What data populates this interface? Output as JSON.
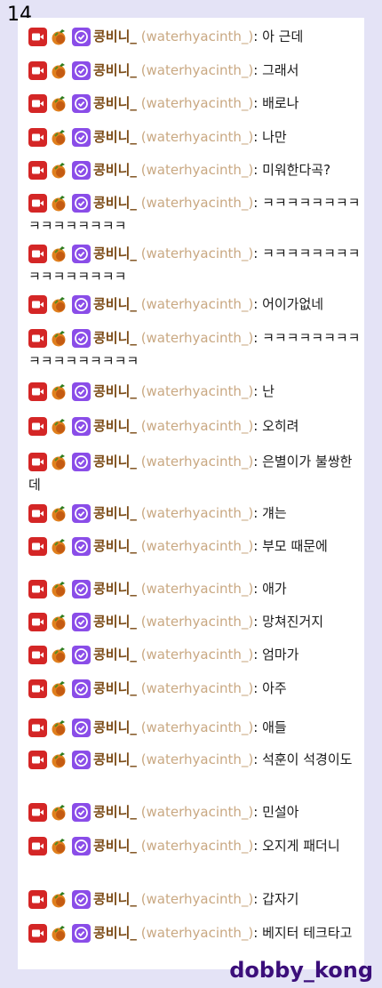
{
  "page_number": "14",
  "user": {
    "name": "콩비니_",
    "handle": "(waterhyacinth_)",
    "separator": ": "
  },
  "badges": [
    "camera-icon",
    "fruit-icon",
    "verified-icon"
  ],
  "colors": {
    "username": "#7b4b16",
    "handle": "#c9a882",
    "camera_badge": "#d42626",
    "verified_badge": "#8a4de8",
    "watermark": "#3b0e7a"
  },
  "messages": [
    "아 근데",
    "그래서",
    "배로나",
    "나만",
    "미워한다곡?",
    "ㅋㅋㅋㅋㅋㅋㅋㅋㅋㅋㅋㅋㅋㅋㅋㅋ",
    "ㅋㅋㅋㅋㅋㅋㅋㅋㅋㅋㅋㅋㅋㅋㅋㅋ",
    "어이가없네",
    "ㅋㅋㅋㅋㅋㅋㅋㅋㅋㅋㅋㅋㅋㅋㅋㅋㅋ",
    "난",
    "오히려",
    "은별이가 불쌍한데",
    "걔는",
    "부모 때문에",
    "애가",
    "망쳐진거지",
    "엄마가",
    "아주",
    "애들",
    "석훈이 석경이도",
    "민설아",
    "오지게 패더니",
    "갑자기",
    "베지터 테크타고"
  ],
  "watermark": "dobby_kong"
}
